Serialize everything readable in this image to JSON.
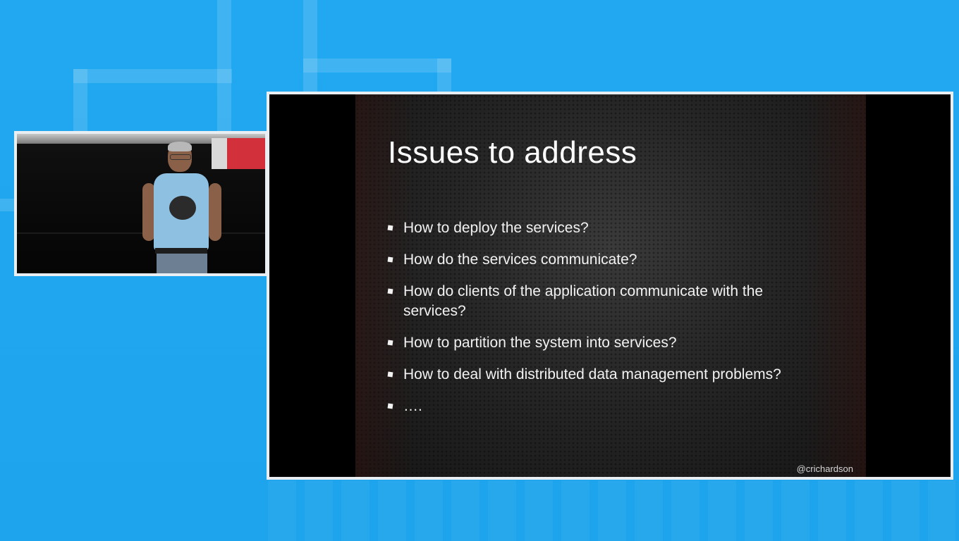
{
  "slide": {
    "title": "Issues to address",
    "bullets": [
      "How to deploy the services?",
      "How do the services communicate?",
      "How do clients of the application communicate with the services?",
      "How to partition the system into services?",
      "How to deal with distributed data management problems?",
      "…."
    ],
    "handle": "@crichardson"
  },
  "colors": {
    "background": "#1fa6ee",
    "frame_border": "#e9eef2",
    "slide_text": "#f2f2f2"
  }
}
